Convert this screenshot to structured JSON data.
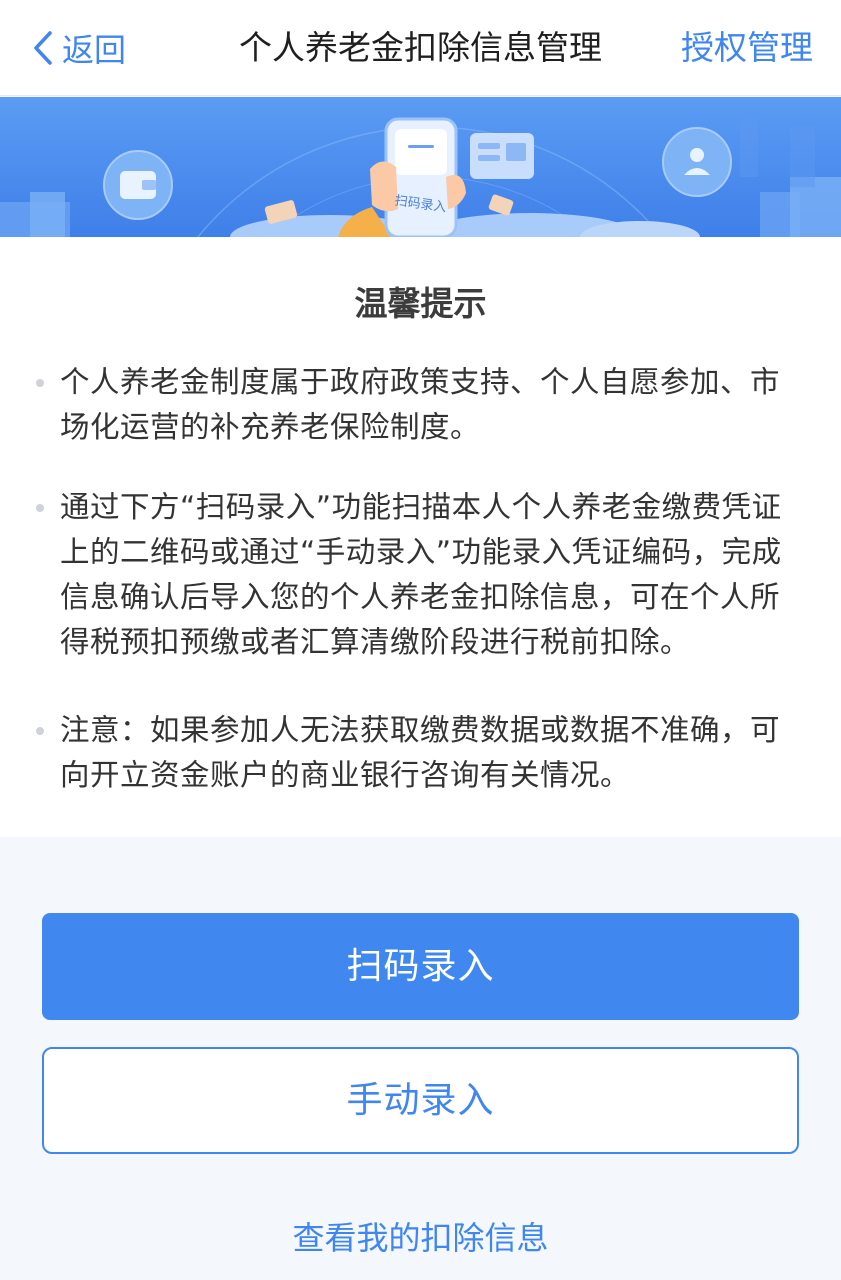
{
  "navbar": {
    "back_label": "返回",
    "title": "个人养老金扣除信息管理",
    "right_label": "授权管理"
  },
  "banner": {
    "phone_label": "扫码录入"
  },
  "tips": {
    "title": "温馨提示",
    "items": [
      "个人养老金制度属于政府政策支持、个人自愿参加、市场化运营的补充养老保险制度。",
      "通过下方“扫码录入”功能扫描本人个人养老金缴费凭证上的二维码或通过“手动录入”功能录入凭证编码，完成信息确认后导入您的个人养老金扣除信息，可在个人所得税预扣预缴或者汇算清缴阶段进行税前扣除。",
      "注意：如果参加人无法获取缴费数据或数据不准确，可向开立资金账户的商业银行咨询有关情况。"
    ]
  },
  "actions": {
    "scan_label": "扫码录入",
    "manual_label": "手动录入",
    "view_label": "查看我的扣除信息"
  },
  "colors": {
    "accent": "#3f86f0",
    "primary_button": "#4088ef",
    "banner": "#4a8cf0"
  },
  "icons": {
    "back": "chevron-left-icon",
    "wallet": "wallet-icon",
    "user": "user-icon",
    "phone": "phone-scan-icon"
  }
}
